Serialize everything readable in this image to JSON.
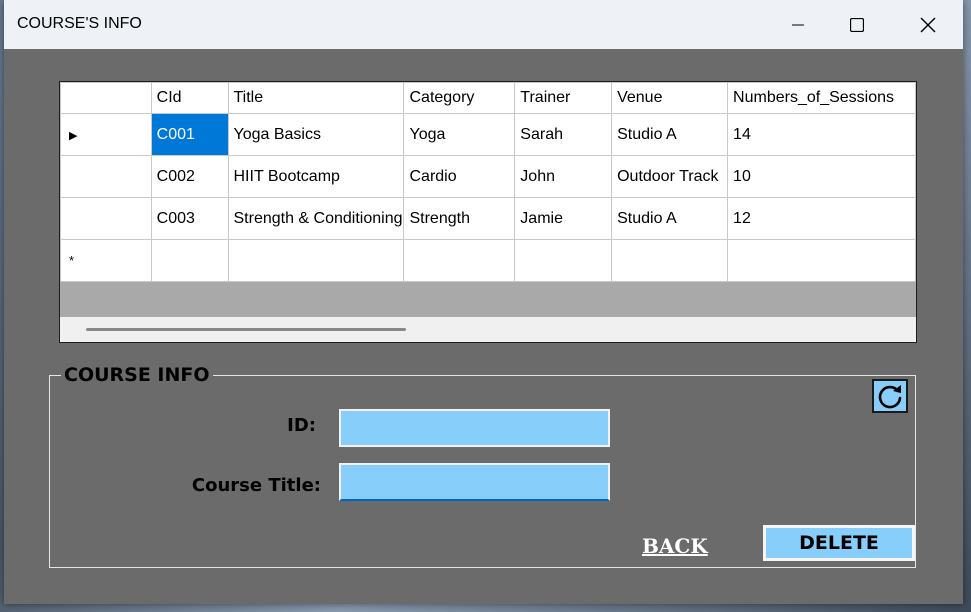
{
  "window": {
    "title": "COURSE'S INFO",
    "controls": [
      "minimize",
      "maximize",
      "close"
    ]
  },
  "grid": {
    "columns": [
      "CId",
      "Title",
      "Category",
      "Trainer",
      "Venue",
      "Numbers_of_Sessions"
    ],
    "rows": [
      [
        "C001",
        "Yoga Basics",
        "Yoga",
        "Sarah",
        "Studio A",
        "14"
      ],
      [
        "C002",
        "HIIT Bootcamp",
        "Cardio",
        "John",
        "Outdoor Track",
        "10"
      ],
      [
        "C003",
        "Strength & Conditioning",
        "Strength",
        "Jamie",
        "Studio A",
        "12"
      ]
    ],
    "current_row_marker": "▶",
    "new_row_marker": "*",
    "selected_cell": "C001"
  },
  "form": {
    "legend": "COURSE INFO",
    "id_label": "ID:",
    "id_value": "",
    "title_label": "Course Title:",
    "title_value": "",
    "back_label": "BACK",
    "delete_label": "DELETE",
    "refresh_icon": "refresh-icon"
  },
  "colors": {
    "input_bg": "#87cefa",
    "selection": "#0078d7",
    "window_bg": "#6b6b6b"
  }
}
